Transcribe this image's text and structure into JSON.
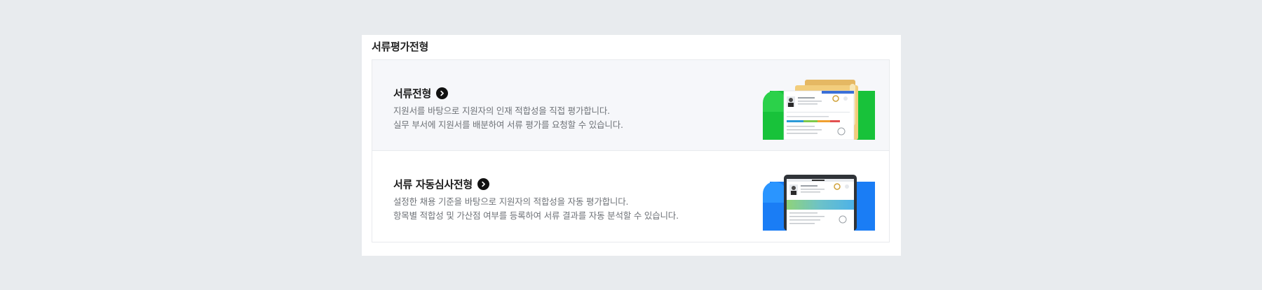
{
  "section": {
    "title": "서류평가전형"
  },
  "cards": [
    {
      "title": "서류전형",
      "lines": [
        "지원서를 바탕으로 지원자의 인재 적합성을 직접 평가합니다.",
        "실무 부서에 지원서를 배분하여 서류 평가를 요청할 수 있습니다."
      ],
      "accent": "#2bc943",
      "icon": "folder-document-illustration"
    },
    {
      "title": "서류 자동심사전형",
      "lines": [
        "설정한 채용 기준을 바탕으로 지원자의 적합성을 자동 평가합니다.",
        "항목별 적합성 및 가산점 여부를 등록하여 서류 결과를 자동 분석할 수 있습니다."
      ],
      "accent": "#1a8cff",
      "icon": "tablet-document-illustration"
    }
  ]
}
